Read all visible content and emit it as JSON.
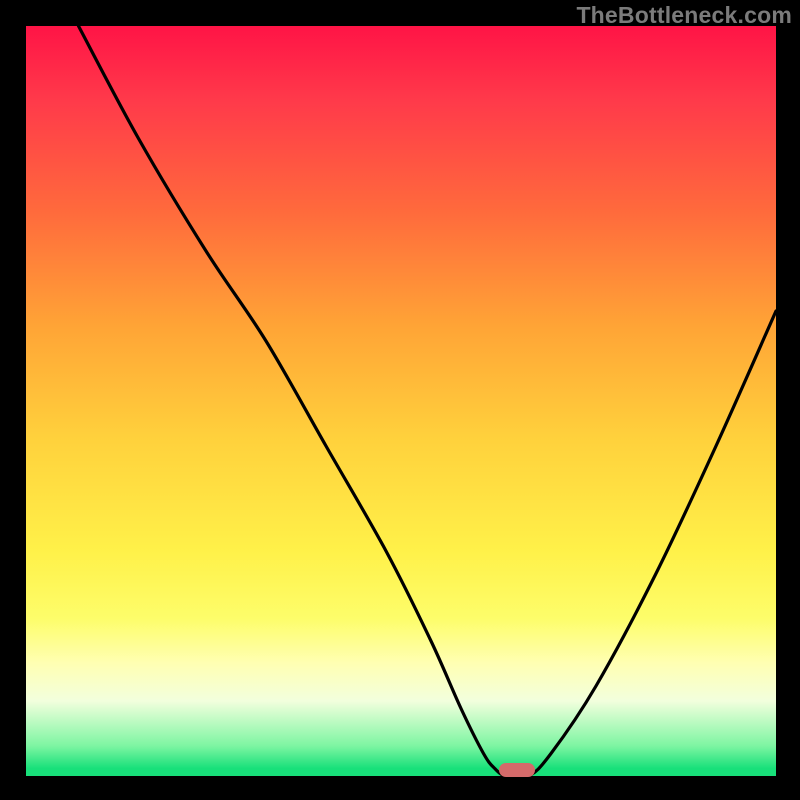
{
  "watermark": "TheBottleneck.com",
  "colors": {
    "frame": "#000000",
    "watermark": "#7b7b7b",
    "curve": "#000000",
    "marker": "#d46a6a"
  },
  "chart_data": {
    "type": "line",
    "title": "",
    "xlabel": "",
    "ylabel": "",
    "xlim": [
      0,
      100
    ],
    "ylim": [
      0,
      100
    ],
    "grid": false,
    "legend": false,
    "background_gradient": [
      {
        "stop": 0,
        "hex": "#ff1446"
      },
      {
        "stop": 10,
        "hex": "#ff3a4a"
      },
      {
        "stop": 25,
        "hex": "#ff6b3c"
      },
      {
        "stop": 40,
        "hex": "#ffa436"
      },
      {
        "stop": 55,
        "hex": "#ffd13c"
      },
      {
        "stop": 70,
        "hex": "#fff149"
      },
      {
        "stop": 79,
        "hex": "#fdfd6a"
      },
      {
        "stop": 85,
        "hex": "#ffffb3"
      },
      {
        "stop": 90,
        "hex": "#f2ffdd"
      },
      {
        "stop": 96,
        "hex": "#7df5a2"
      },
      {
        "stop": 99,
        "hex": "#18e07a"
      },
      {
        "stop": 100,
        "hex": "#18e07a"
      }
    ],
    "series": [
      {
        "name": "bottleneck-curve",
        "x": [
          7,
          15,
          24,
          32,
          40,
          48,
          54,
          58,
          61,
          62.5,
          64,
          67,
          70,
          76,
          84,
          92,
          100
        ],
        "y": [
          100,
          85,
          70,
          58,
          44,
          30,
          18,
          9,
          3,
          1,
          0,
          0,
          3,
          12,
          27,
          44,
          62
        ]
      }
    ],
    "marker": {
      "x": 65.5,
      "y": 0.8
    }
  }
}
